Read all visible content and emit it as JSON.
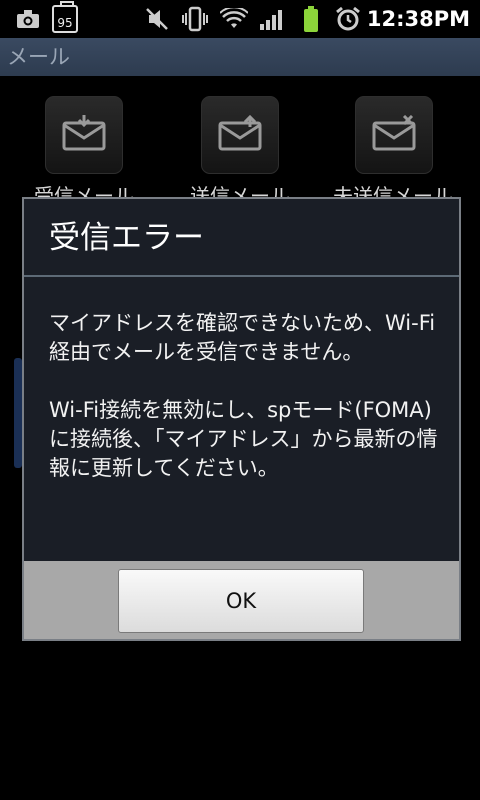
{
  "status_bar": {
    "battery_badge": "95",
    "time": "12:38PM",
    "icons": [
      "camera-icon",
      "battery-95-icon",
      "mute-icon",
      "vibrate-icon",
      "wifi-icon",
      "signal-icon",
      "battery-icon",
      "alarm-icon"
    ]
  },
  "app": {
    "title": "メール"
  },
  "tiles": [
    {
      "label": "受信メール",
      "icon": "inbox-icon"
    },
    {
      "label": "送信メール",
      "icon": "outbox-icon"
    },
    {
      "label": "未送信メール",
      "icon": "unsent-icon"
    }
  ],
  "dialog": {
    "title": "受信エラー",
    "message1": "マイアドレスを確認できないため、Wi-Fi経由でメールを受信できません。",
    "message2": "Wi-Fi接続を無効にし、spモード(FOMA)に接続後、「マイアドレス」から最新の情報に更新してください。",
    "ok_label": "OK"
  }
}
